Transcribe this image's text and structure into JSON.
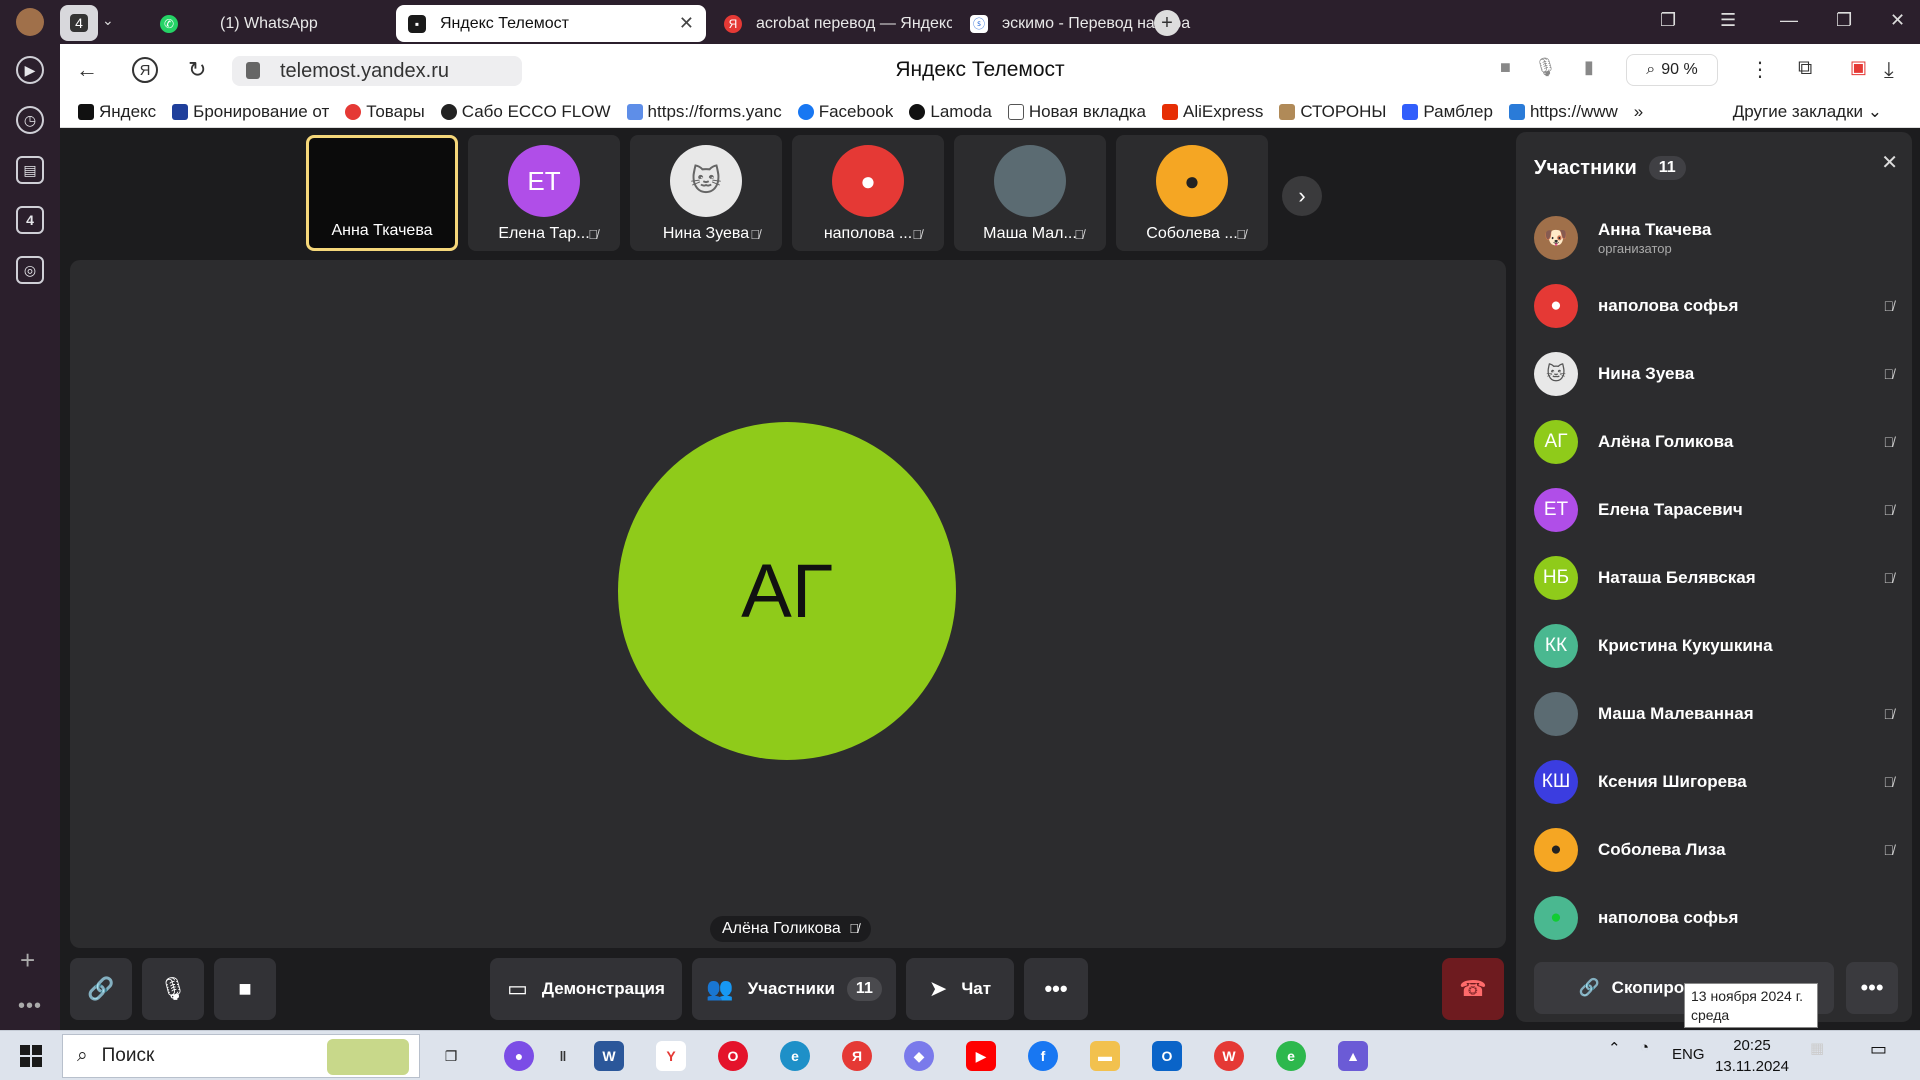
{
  "browser": {
    "tab_count_badge": "4",
    "tabs": [
      {
        "label": "(1) WhatsApp"
      },
      {
        "label": "Яндекс Телемост"
      },
      {
        "label": "acrobat перевод — Яндекс"
      },
      {
        "label": "эскимо - Перевод на фра"
      }
    ],
    "url": "telemost.yandex.ru",
    "page_title": "Яндекс Телемост",
    "zoom": "90 %",
    "bookmarks": [
      {
        "label": "Яндекс"
      },
      {
        "label": "Бронирование от"
      },
      {
        "label": "Товары"
      },
      {
        "label": "Сабо ECCO FLOW"
      },
      {
        "label": "https://forms.yanc"
      },
      {
        "label": "Facebook"
      },
      {
        "label": "Lamoda"
      },
      {
        "label": "Новая вкладка"
      },
      {
        "label": "AliExpress"
      },
      {
        "label": "СТОРОНЫ"
      },
      {
        "label": "Рамблер"
      },
      {
        "label": "https://www"
      }
    ],
    "other_bookmarks": "Другие закладки",
    "sidebar_badge": "4"
  },
  "call": {
    "thumbnails": [
      {
        "name": "Анна Ткачева",
        "initials": ""
      },
      {
        "name": "Елена Тар...",
        "initials": "ЕТ"
      },
      {
        "name": "Нина Зуева",
        "initials": ""
      },
      {
        "name": "наполова ...",
        "initials": ""
      },
      {
        "name": "Маша Мал...",
        "initials": ""
      },
      {
        "name": "Соболева ...",
        "initials": ""
      }
    ],
    "speaker": {
      "initials": "АГ",
      "name": "Алёна Голикова"
    },
    "controls": {
      "demo": "Демонстрация",
      "participants": "Участники",
      "participants_count": "11",
      "chat": "Чат"
    }
  },
  "panel": {
    "title": "Участники",
    "count": "11",
    "participants": [
      {
        "name": "Анна Ткачева",
        "role": "организатор",
        "initials": ""
      },
      {
        "name": "наполова софья",
        "initials": ""
      },
      {
        "name": "Нина Зуева",
        "initials": ""
      },
      {
        "name": "Алёна Голикова",
        "initials": "АГ"
      },
      {
        "name": "Елена Тарасевич",
        "initials": "ЕТ"
      },
      {
        "name": "Наташа Белявская",
        "initials": "НБ"
      },
      {
        "name": "Кристина Кукушкина",
        "initials": "КК"
      },
      {
        "name": "Маша Малеванная",
        "initials": ""
      },
      {
        "name": "Ксения Шигорева",
        "initials": "КШ"
      },
      {
        "name": "Соболева Лиза",
        "initials": ""
      },
      {
        "name": "наполова софья",
        "initials": ""
      }
    ],
    "copy_link": "Скопировать ссылку"
  },
  "tooltip": {
    "date": "13 ноября 2024 г.",
    "weekday": "среда"
  },
  "taskbar": {
    "search": "Поиск",
    "lang": "ENG",
    "time": "20:25",
    "date": "13.11.2024"
  },
  "colors": {
    "ag": "#8fcb1a",
    "et": "#b04ee8",
    "nb": "#8fcb1a",
    "kk": "#4ab890",
    "ksh": "#3b3de0",
    "red": "#e53935",
    "orange": "#f5a623",
    "green": "#4ab890"
  }
}
